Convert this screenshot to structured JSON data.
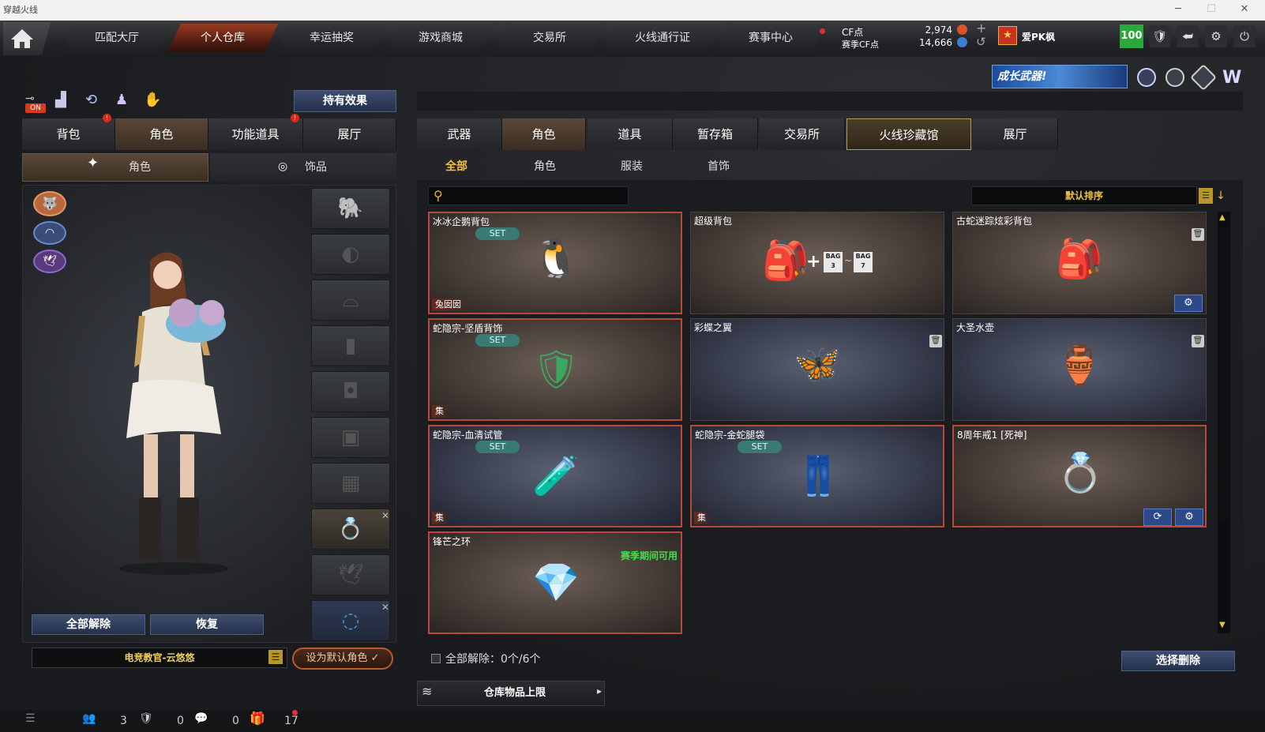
{
  "window": {
    "title": "穿越火线",
    "minimize": "─",
    "maximize": "☐",
    "close": "✕"
  },
  "nav": {
    "home_icon": "house-icon",
    "tabs": [
      "匹配大厅",
      "个人仓库",
      "幸运抽奖",
      "游戏商城",
      "交易所",
      "火线通行证",
      "赛事中心"
    ],
    "active": "个人仓库"
  },
  "currency": {
    "cf_label": "CF点",
    "cf_value": "2,974",
    "event_label": "赛季CF点",
    "event_value": "14,666",
    "plus": "+",
    "refresh": "↺"
  },
  "player": {
    "name": "爱PK枫",
    "level": "100"
  },
  "banner": {
    "text": "成长武器!"
  },
  "left": {
    "toggle": "ON",
    "effect_button": "持有效果",
    "tabs": [
      "背包",
      "角色",
      "功能道具",
      "展厅"
    ],
    "active_tab": "角色",
    "subtabs": [
      "角色",
      "饰品"
    ],
    "unequip_all": "全部解除",
    "restore": "恢复",
    "role_name": "电竞教官-云悠悠",
    "set_default": "设为默认角色 ✓"
  },
  "right": {
    "tabs": [
      "武器",
      "角色",
      "道具",
      "暂存箱",
      "交易所",
      "火线珍藏馆",
      "展厅"
    ],
    "active_tab": "角色",
    "subtabs": [
      "全部",
      "角色",
      "服装",
      "首饰"
    ],
    "active_subtab": "全部",
    "search_placeholder": "",
    "sort_label": "默认排序",
    "items": [
      {
        "name": "冰冰企鹅背包",
        "set": "SET",
        "tag": "兔囡囡",
        "icon": "🐧"
      },
      {
        "name": "超级背包",
        "set": "",
        "tag": "",
        "icon": "🎒"
      },
      {
        "name": "古蛇迷踪炫彩背包",
        "set": "",
        "tag": "",
        "icon": "🎒"
      },
      {
        "name": "蛇隐宗-坚盾背饰",
        "set": "SET",
        "tag": "集",
        "icon": "🛡"
      },
      {
        "name": "彩蝶之翼",
        "set": "",
        "tag": "",
        "icon": "🦋"
      },
      {
        "name": "大圣水壶",
        "set": "",
        "tag": "",
        "icon": "🏺"
      },
      {
        "name": "蛇隐宗-血清试管",
        "set": "SET",
        "tag": "集",
        "icon": "🧪"
      },
      {
        "name": "蛇隐宗-金蛇腿袋",
        "set": "SET",
        "tag": "集",
        "icon": "👖"
      },
      {
        "name": "8周年戒1 [死神]",
        "set": "",
        "tag": "",
        "icon": "💍"
      },
      {
        "name": "锋芒之环",
        "set": "",
        "tag": "",
        "icon": "💎",
        "note": "赛季期间可用"
      }
    ],
    "bag_extra": [
      "BAG 3",
      "BAG 7"
    ],
    "unequip_status": "全部解除：0个/6个",
    "select_delete": "选择删除",
    "storage_limit": "仓库物品上限"
  },
  "bottom": {
    "friends": "3",
    "guild": "0",
    "chat": "0",
    "gift": "17"
  }
}
